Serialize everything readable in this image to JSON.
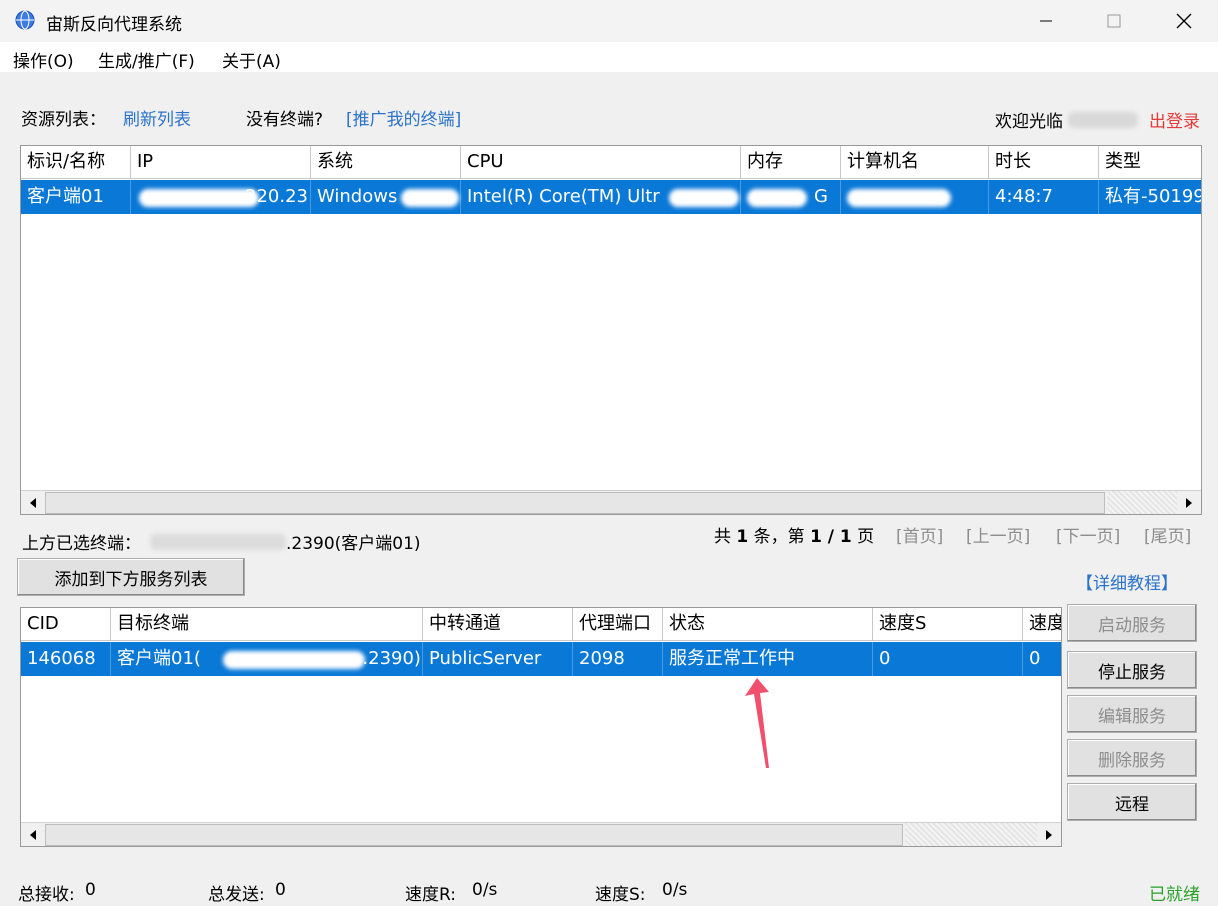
{
  "window": {
    "title": "宙斯反向代理系统"
  },
  "menu": [
    "操作(O)",
    "生成/推广(F)",
    "关于(A)"
  ],
  "top": {
    "resource_label": "资源列表：",
    "refresh_link": "刷新列表",
    "no_terminal": "没有终端?",
    "promote_link": "[推广我的终端]",
    "welcome": "欢迎光临",
    "logout": "出登录"
  },
  "terminals": {
    "columns": [
      "标识/名称",
      "IP",
      "系统",
      "CPU",
      "内存",
      "计算机名",
      "时长",
      "类型"
    ],
    "rows": [
      {
        "name": "客户端01",
        "ip": ".220.23",
        "os": "Windows",
        "cpu": "Intel(R) Core(TM) Ultr",
        "mem": "G",
        "computer": "",
        "duration": "4:48:7",
        "type": "私有-50199"
      }
    ]
  },
  "selection": {
    "label": "上方已选终端：",
    "value": ".2390(客户端01)"
  },
  "pager": {
    "total_prefix": "共",
    "total": "1",
    "total_mid": "条，第",
    "page": "1 / 1",
    "page_suffix": "页",
    "first": "[首页]",
    "prev": "[上一页]",
    "next": "[下一页]",
    "last": "[尾页]"
  },
  "add_button": "添加到下方服务列表",
  "tutorial_link": "【详细教程】",
  "services": {
    "columns": [
      "CID",
      "目标终端",
      "中转通道",
      "代理端口",
      "状态",
      "速度S",
      "速度"
    ],
    "rows": [
      {
        "cid": "146068",
        "target_prefix": "客户端01(",
        "target_suffix": ".2390)",
        "channel": "PublicServer",
        "port": "2098",
        "status": "服务正常工作中",
        "speed_s": "0",
        "speed_r": "0"
      }
    ]
  },
  "side_buttons": {
    "start": "启动服务",
    "stop": "停止服务",
    "edit": "编辑服务",
    "delete": "删除服务",
    "remote": "远程"
  },
  "status_bar": {
    "recv_label": "总接收:",
    "recv": "0",
    "send_label": "总发送:",
    "send": "0",
    "speed_r_label": "速度R:",
    "speed_r": "0/s",
    "speed_s_label": "速度S:",
    "speed_s": "0/s",
    "state": "已就绪"
  },
  "colors": {
    "selection": "#0a78d7",
    "link": "#2b73c9",
    "logout": "#e33b3b",
    "ready": "#2aa12a",
    "arrow": "#f0506e"
  }
}
